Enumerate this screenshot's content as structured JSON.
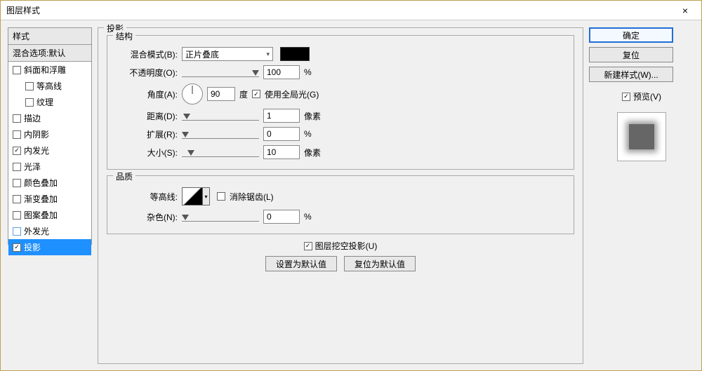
{
  "window": {
    "title": "图层样式",
    "close": "×"
  },
  "styles": {
    "header": "样式",
    "blend_defaults": "混合选项:默认",
    "items": [
      {
        "label": "斜面和浮雕",
        "checked": false,
        "indent": false
      },
      {
        "label": "等高线",
        "checked": false,
        "indent": true
      },
      {
        "label": "纹理",
        "checked": false,
        "indent": true
      },
      {
        "label": "描边",
        "checked": false,
        "indent": false
      },
      {
        "label": "内阴影",
        "checked": false,
        "indent": false
      },
      {
        "label": "内发光",
        "checked": true,
        "indent": false
      },
      {
        "label": "光泽",
        "checked": false,
        "indent": false
      },
      {
        "label": "颜色叠加",
        "checked": false,
        "indent": false
      },
      {
        "label": "渐变叠加",
        "checked": false,
        "indent": false
      },
      {
        "label": "图案叠加",
        "checked": false,
        "indent": false
      },
      {
        "label": "外发光",
        "checked": false,
        "indent": false,
        "disabled_look": true
      },
      {
        "label": "投影",
        "checked": true,
        "indent": false,
        "selected": true
      }
    ]
  },
  "panel": {
    "section_title": "投影",
    "structure": {
      "legend": "结构",
      "blend_mode_label": "混合模式(B):",
      "blend_mode_value": "正片叠底",
      "opacity_label": "不透明度(O):",
      "opacity_value": "100",
      "opacity_unit": "%",
      "angle_label": "角度(A):",
      "angle_value": "90",
      "angle_unit": "度",
      "global_light_label": "使用全局光(G)",
      "global_light_checked": true,
      "distance_label": "距离(D):",
      "distance_value": "1",
      "distance_unit": "像素",
      "spread_label": "扩展(R):",
      "spread_value": "0",
      "spread_unit": "%",
      "size_label": "大小(S):",
      "size_value": "10",
      "size_unit": "像素"
    },
    "quality": {
      "legend": "品质",
      "contour_label": "等高线:",
      "antialias_label": "消除锯齿(L)",
      "antialias_checked": false,
      "noise_label": "杂色(N):",
      "noise_value": "0",
      "noise_unit": "%"
    },
    "knockout_label": "图层挖空投影(U)",
    "knockout_checked": true,
    "make_default": "设置为默认值",
    "reset_default": "复位为默认值"
  },
  "right": {
    "ok": "确定",
    "cancel": "复位",
    "new_style": "新建样式(W)...",
    "preview_label": "预览(V)",
    "preview_checked": true
  }
}
